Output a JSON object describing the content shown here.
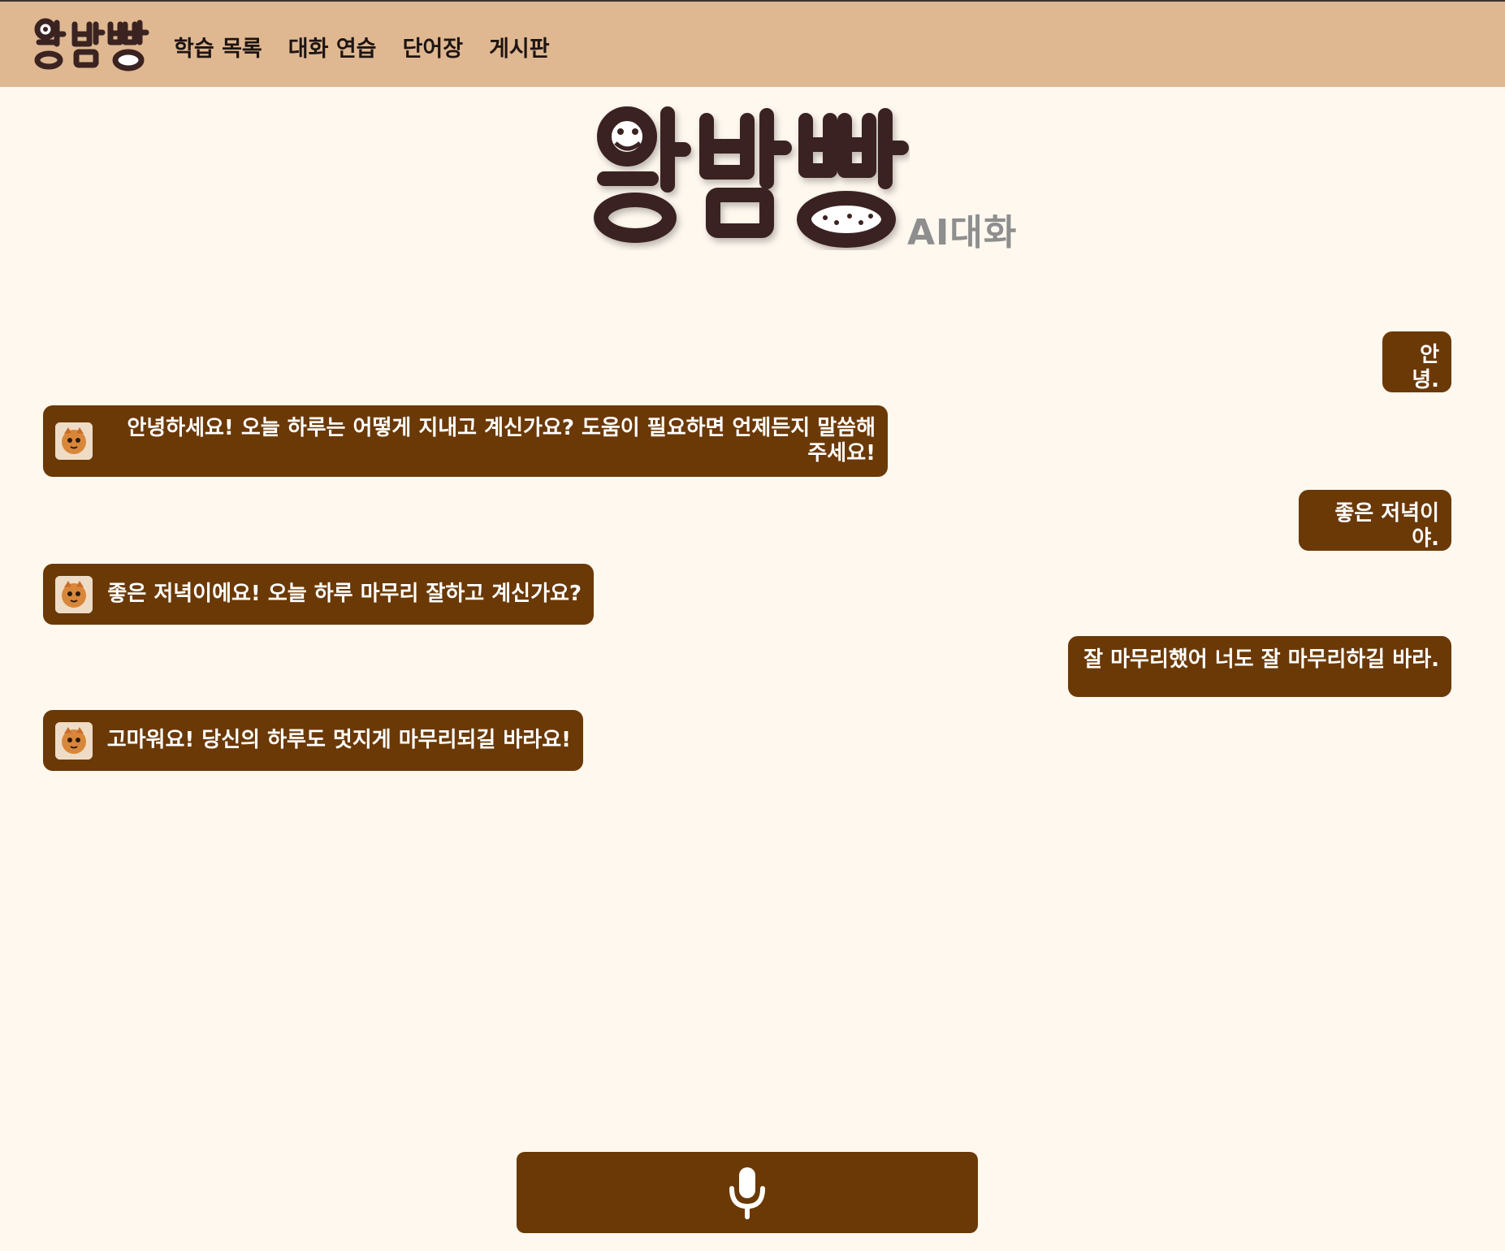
{
  "navbar": {
    "logo_text": "왕밤빵",
    "links": [
      {
        "label": "학습 목록"
      },
      {
        "label": "대화 연습"
      },
      {
        "label": "단어장"
      },
      {
        "label": "게시판"
      }
    ]
  },
  "hero": {
    "logo_text": "왕밤빵",
    "subtitle": "AI대화"
  },
  "chat": {
    "messages": [
      {
        "role": "user",
        "text": "안녕."
      },
      {
        "role": "ai",
        "text": "안녕하세요! 오늘 하루는 어떻게 지내고 계신가요? 도움이 필요하면 언제든지 말씀해 주세요!"
      },
      {
        "role": "user",
        "text": "좋은 저녁이야."
      },
      {
        "role": "ai",
        "text": "좋은 저녁이에요! 오늘 하루 마무리 잘하고 계신가요?"
      },
      {
        "role": "user",
        "text": "잘 마무리했어 너도 잘 마무리하길 바라."
      },
      {
        "role": "ai",
        "text": "고마워요! 당신의 하루도 멋지게 마무리되길 바라요!"
      }
    ]
  },
  "mic": {
    "icon": "microphone-icon"
  },
  "colors": {
    "navbar_bg": "#dfb892",
    "page_bg": "#fff8ef",
    "bubble_bg": "#6b3906",
    "logo_dark": "#3a2320"
  }
}
